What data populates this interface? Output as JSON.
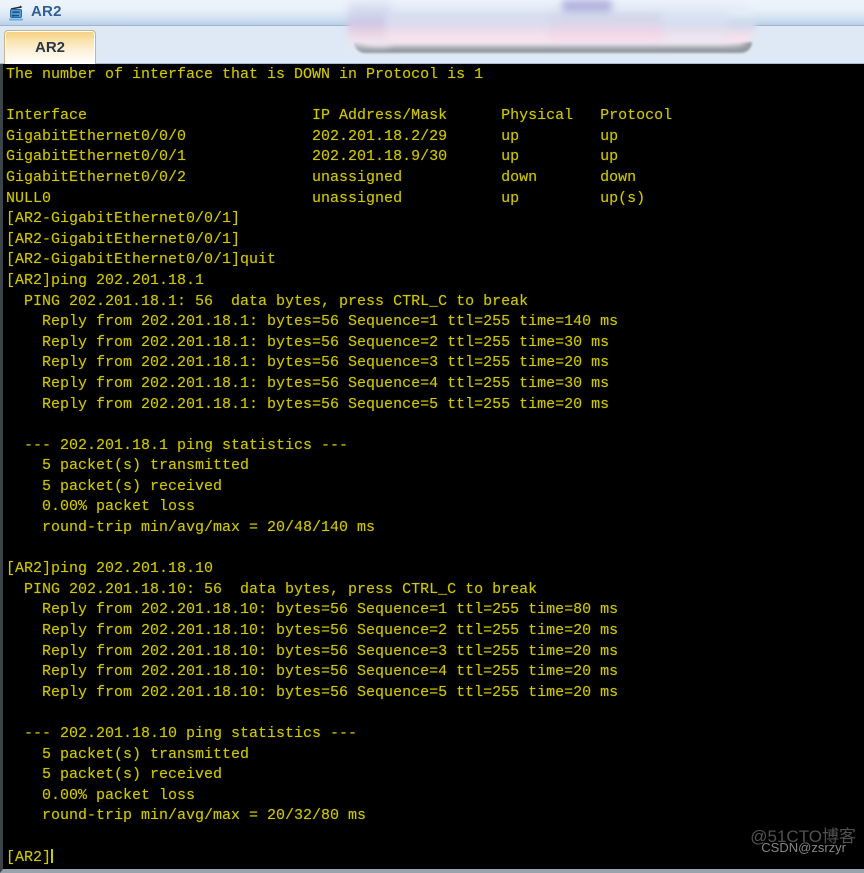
{
  "window": {
    "title": "AR2",
    "icon": "router-icon"
  },
  "tabs": [
    {
      "label": "AR2",
      "active": true
    }
  ],
  "terminal": {
    "colors": {
      "background": "#000000",
      "foreground": "#cfc800"
    },
    "prompt": "[AR2]",
    "lines": [
      "The number of interface that is DOWN in Protocol is 1",
      "",
      "Interface                         IP Address/Mask      Physical   Protocol",
      "GigabitEthernet0/0/0              202.201.18.2/29      up         up",
      "GigabitEthernet0/0/1              202.201.18.9/30      up         up",
      "GigabitEthernet0/0/2              unassigned           down       down",
      "NULL0                             unassigned           up         up(s)",
      "[AR2-GigabitEthernet0/0/1]",
      "[AR2-GigabitEthernet0/0/1]",
      "[AR2-GigabitEthernet0/0/1]quit",
      "[AR2]ping 202.201.18.1",
      "  PING 202.201.18.1: 56  data bytes, press CTRL_C to break",
      "    Reply from 202.201.18.1: bytes=56 Sequence=1 ttl=255 time=140 ms",
      "    Reply from 202.201.18.1: bytes=56 Sequence=2 ttl=255 time=30 ms",
      "    Reply from 202.201.18.1: bytes=56 Sequence=3 ttl=255 time=20 ms",
      "    Reply from 202.201.18.1: bytes=56 Sequence=4 ttl=255 time=30 ms",
      "    Reply from 202.201.18.1: bytes=56 Sequence=5 ttl=255 time=20 ms",
      "",
      "  --- 202.201.18.1 ping statistics ---",
      "    5 packet(s) transmitted",
      "    5 packet(s) received",
      "    0.00% packet loss",
      "    round-trip min/avg/max = 20/48/140 ms",
      "",
      "[AR2]ping 202.201.18.10",
      "  PING 202.201.18.10: 56  data bytes, press CTRL_C to break",
      "    Reply from 202.201.18.10: bytes=56 Sequence=1 ttl=255 time=80 ms",
      "    Reply from 202.201.18.10: bytes=56 Sequence=2 ttl=255 time=20 ms",
      "    Reply from 202.201.18.10: bytes=56 Sequence=3 ttl=255 time=20 ms",
      "    Reply from 202.201.18.10: bytes=56 Sequence=4 ttl=255 time=20 ms",
      "    Reply from 202.201.18.10: bytes=56 Sequence=5 ttl=255 time=20 ms",
      "",
      "  --- 202.201.18.10 ping statistics ---",
      "    5 packet(s) transmitted",
      "    5 packet(s) received",
      "    0.00% packet loss",
      "    round-trip min/avg/max = 20/32/80 ms",
      "",
      "[AR2]"
    ],
    "interface_table": {
      "headers": [
        "Interface",
        "IP Address/Mask",
        "Physical",
        "Protocol"
      ],
      "rows": [
        [
          "GigabitEthernet0/0/0",
          "202.201.18.2/29",
          "up",
          "up"
        ],
        [
          "GigabitEthernet0/0/1",
          "202.201.18.9/30",
          "up",
          "up"
        ],
        [
          "GigabitEthernet0/0/2",
          "unassigned",
          "down",
          "down"
        ],
        [
          "NULL0",
          "unassigned",
          "up",
          "up(s)"
        ]
      ],
      "summary": "The number of interface that is DOWN in Protocol is 1"
    },
    "ping_results": [
      {
        "target": "202.201.18.1",
        "size": "56",
        "transmitted": "5",
        "received": "5",
        "loss": "0.00%",
        "min": "20",
        "avg": "48",
        "max": "140",
        "unit": "ms",
        "times": [
          "140",
          "30",
          "20",
          "30",
          "20"
        ]
      },
      {
        "target": "202.201.18.10",
        "size": "56",
        "transmitted": "5",
        "received": "5",
        "loss": "0.00%",
        "min": "20",
        "avg": "32",
        "max": "80",
        "unit": "ms",
        "times": [
          "80",
          "20",
          "20",
          "20",
          "20"
        ]
      }
    ]
  },
  "watermarks": {
    "primary": "@51CTO博客",
    "secondary": "CSDN@zsrzyr"
  }
}
